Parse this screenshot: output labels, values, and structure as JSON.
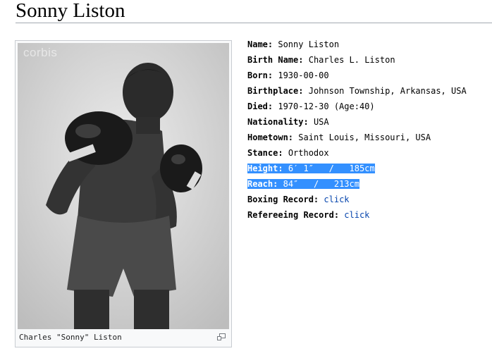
{
  "page": {
    "title": "Sonny Liston"
  },
  "image": {
    "watermark": "corbis",
    "caption": "Charles \"Sonny\" Liston",
    "enlarge_icon": "magnify-clip-icon"
  },
  "info": {
    "name": {
      "label": "Name:",
      "value": "Sonny Liston"
    },
    "birth_name": {
      "label": "Birth Name:",
      "value": "Charles L. Liston"
    },
    "born": {
      "label": "Born:",
      "value": "1930-00-00"
    },
    "birthplace": {
      "label": "Birthplace:",
      "value": "Johnson Township, Arkansas, USA"
    },
    "died": {
      "label": "Died:",
      "value": "1970-12-30 (Age:40)"
    },
    "nationality": {
      "label": "Nationality:",
      "value": "USA"
    },
    "hometown": {
      "label": "Hometown:",
      "value": "Saint Louis, Missouri, USA"
    },
    "stance": {
      "label": "Stance:",
      "value": "Orthodox"
    },
    "height": {
      "label": "Height:",
      "value": "6′ 1″   /   185cm"
    },
    "reach": {
      "label": "Reach:",
      "value": "84″   /   213cm"
    },
    "boxing_record": {
      "label": "Boxing Record:",
      "link": "click"
    },
    "refereeing_record": {
      "label": "Refereeing Record:",
      "link": "click"
    }
  },
  "colors": {
    "selection": "#3390ff",
    "link": "#0645ad",
    "rule": "#a2a9b1"
  }
}
